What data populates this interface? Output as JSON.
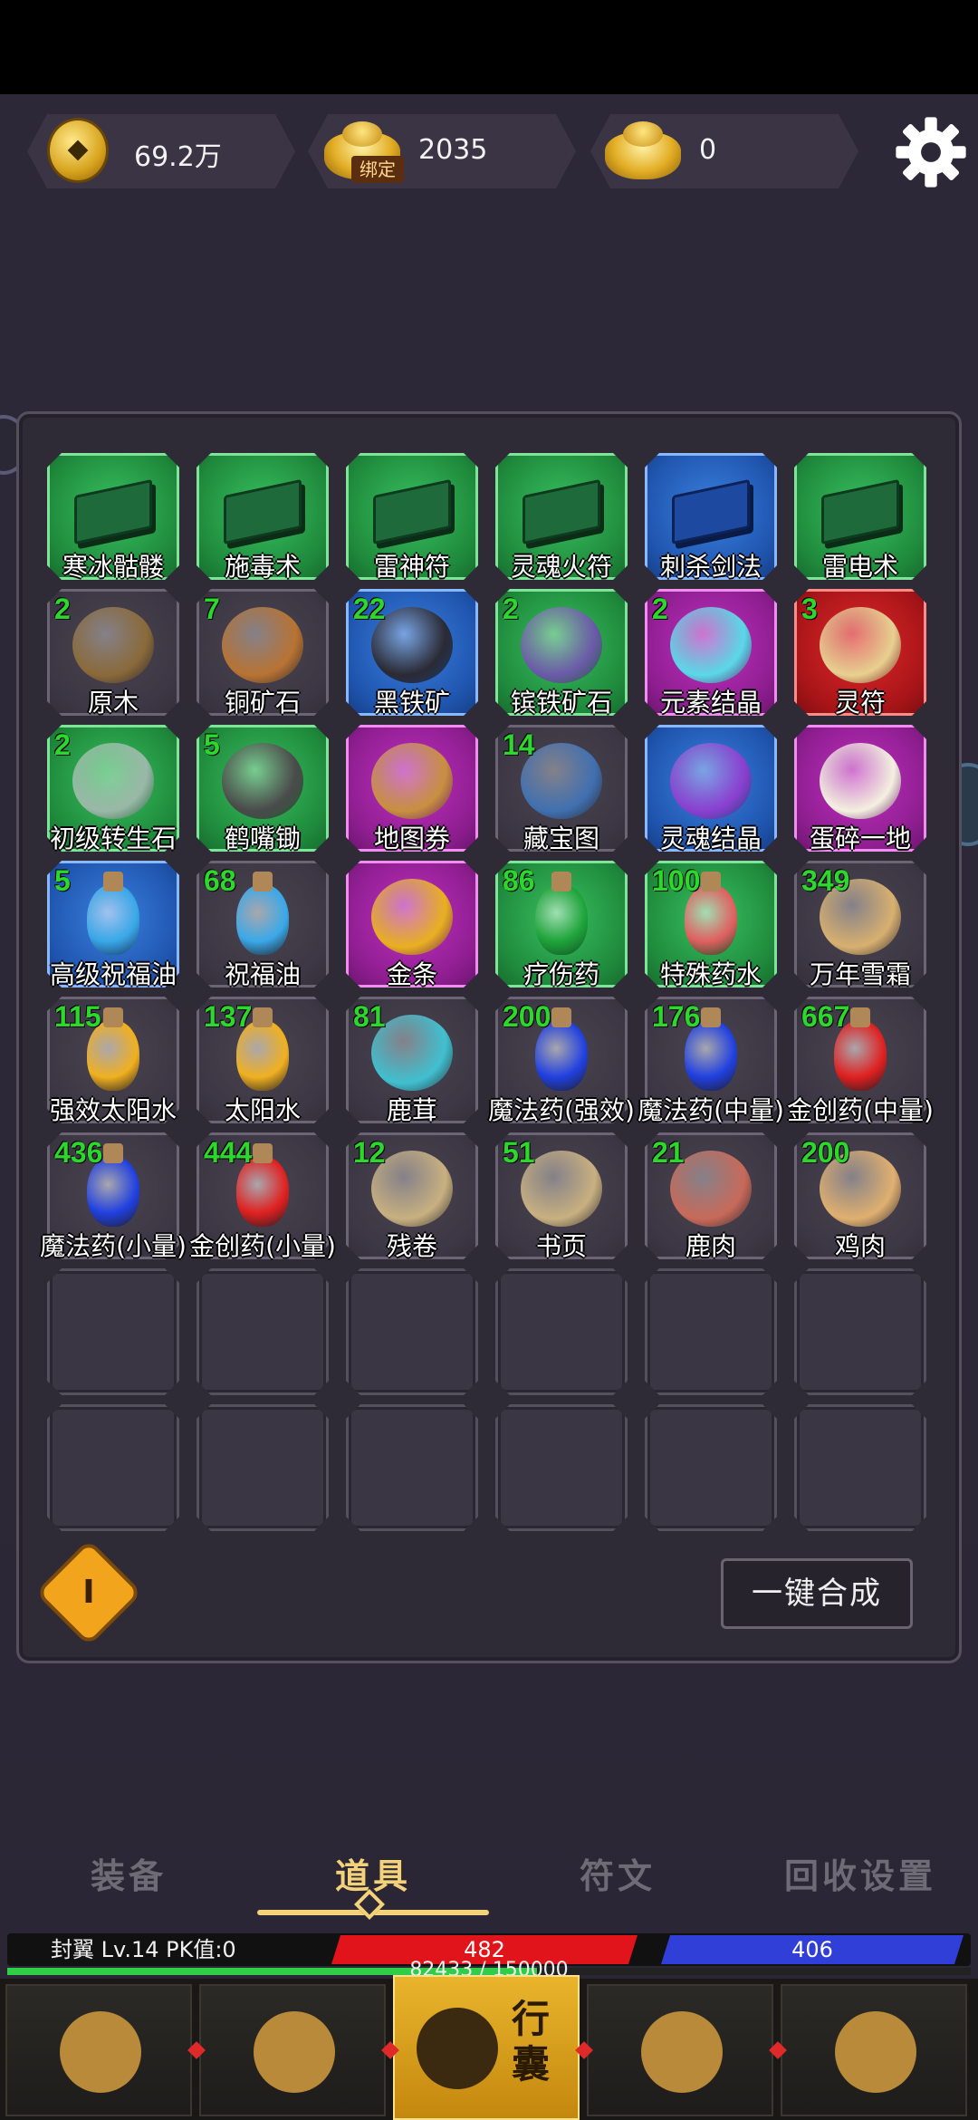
{
  "currencies": [
    {
      "name": "coin",
      "amount": "69.2万"
    },
    {
      "name": "bound-ingot",
      "amount": "2035",
      "tag": "绑定"
    },
    {
      "name": "ingot",
      "amount": "0"
    }
  ],
  "inventory": [
    {
      "label": "寒冰骷髅",
      "count": "",
      "rarity": "green",
      "icon": "skill-book-icon"
    },
    {
      "label": "施毒术",
      "count": "",
      "rarity": "green",
      "icon": "skill-book-icon"
    },
    {
      "label": "雷神符",
      "count": "",
      "rarity": "green",
      "icon": "skill-book-icon"
    },
    {
      "label": "灵魂火符",
      "count": "",
      "rarity": "green",
      "icon": "skill-book-icon"
    },
    {
      "label": "刺杀剑法",
      "count": "",
      "rarity": "blue",
      "icon": "skill-book-icon"
    },
    {
      "label": "雷电术",
      "count": "",
      "rarity": "green",
      "icon": "skill-book-icon"
    },
    {
      "label": "原木",
      "count": "2",
      "rarity": "grey",
      "icon": "log-icon"
    },
    {
      "label": "铜矿石",
      "count": "7",
      "rarity": "grey",
      "icon": "copper-ore-icon"
    },
    {
      "label": "黑铁矿",
      "count": "22",
      "rarity": "blue",
      "icon": "black-iron-ore-icon"
    },
    {
      "label": "镔铁矿石",
      "count": "2",
      "rarity": "green",
      "icon": "crystal-ore-icon"
    },
    {
      "label": "元素结晶",
      "count": "2",
      "rarity": "purple",
      "icon": "element-crystal-icon"
    },
    {
      "label": "灵符",
      "count": "3",
      "rarity": "red",
      "icon": "talisman-icon"
    },
    {
      "label": "初级转生石",
      "count": "2",
      "rarity": "green",
      "icon": "rebirth-stone-icon"
    },
    {
      "label": "鹤嘴锄",
      "count": "5",
      "rarity": "green",
      "icon": "pickaxe-icon"
    },
    {
      "label": "地图券",
      "count": "",
      "rarity": "purple",
      "icon": "map-scroll-icon"
    },
    {
      "label": "藏宝图",
      "count": "14",
      "rarity": "grey",
      "icon": "treasure-map-icon"
    },
    {
      "label": "灵魂结晶",
      "count": "",
      "rarity": "blue",
      "icon": "soul-crystal-icon"
    },
    {
      "label": "蛋碎一地",
      "count": "",
      "rarity": "purple",
      "icon": "broken-egg-icon"
    },
    {
      "label": "高级祝福油",
      "count": "5",
      "rarity": "blue",
      "icon": "blessing-oil-icon"
    },
    {
      "label": "祝福油",
      "count": "68",
      "rarity": "grey",
      "icon": "blessing-oil-icon"
    },
    {
      "label": "金条",
      "count": "",
      "rarity": "purple",
      "icon": "gold-bar-icon"
    },
    {
      "label": "疗伤药",
      "count": "86",
      "rarity": "green",
      "icon": "healing-potion-icon"
    },
    {
      "label": "特殊药水",
      "count": "100",
      "rarity": "green",
      "icon": "special-potion-icon"
    },
    {
      "label": "万年雪霜",
      "count": "349",
      "rarity": "grey",
      "icon": "ginseng-icon"
    },
    {
      "label": "强效太阳水",
      "count": "115",
      "rarity": "grey",
      "icon": "sun-water-icon"
    },
    {
      "label": "太阳水",
      "count": "137",
      "rarity": "grey",
      "icon": "sun-water-icon"
    },
    {
      "label": "鹿茸",
      "count": "81",
      "rarity": "grey",
      "icon": "antler-icon"
    },
    {
      "label": "魔法药(强效)",
      "count": "200",
      "rarity": "grey",
      "icon": "mana-potion-icon"
    },
    {
      "label": "魔法药(中量)",
      "count": "176",
      "rarity": "grey",
      "icon": "mana-potion-icon"
    },
    {
      "label": "金创药(中量)",
      "count": "667",
      "rarity": "grey",
      "icon": "hp-potion-icon"
    },
    {
      "label": "魔法药(小量)",
      "count": "436",
      "rarity": "grey",
      "icon": "mana-potion-icon"
    },
    {
      "label": "金创药(小量)",
      "count": "444",
      "rarity": "grey",
      "icon": "hp-potion-icon"
    },
    {
      "label": "残卷",
      "count": "12",
      "rarity": "grey",
      "icon": "scroll-fragment-icon"
    },
    {
      "label": "书页",
      "count": "51",
      "rarity": "grey",
      "icon": "book-page-icon"
    },
    {
      "label": "鹿肉",
      "count": "21",
      "rarity": "grey",
      "icon": "venison-icon"
    },
    {
      "label": "鸡肉",
      "count": "200",
      "rarity": "grey",
      "icon": "chicken-icon"
    }
  ],
  "empty_slots": 12,
  "page_badge": "Ⅰ",
  "merge_button": "一键合成",
  "tabs": [
    {
      "label": "装备",
      "active": false
    },
    {
      "label": "道具",
      "active": true
    },
    {
      "label": "符文",
      "active": false
    },
    {
      "label": "回收设置",
      "active": false
    }
  ],
  "player": {
    "name_line": "封翼  Lv.14 PK值:0",
    "hp": "482",
    "mp": "406",
    "xp_text": "82433 / 150000",
    "xp_fraction": 0.5496
  },
  "nav": [
    {
      "icon": "town-gate-icon",
      "label": ""
    },
    {
      "icon": "helmet-icon",
      "label": ""
    },
    {
      "icon": "bag-icon",
      "label": "行囊",
      "active": true
    },
    {
      "icon": "meditation-icon",
      "label": ""
    },
    {
      "icon": "yin-yang-icon",
      "label": ""
    }
  ],
  "colors": {
    "green": "#1f8a3c",
    "blue": "#1f55ae",
    "purple": "#8e1e90",
    "red": "#a81518",
    "count_text": "#2bd82b",
    "active_tab": "#f4d27a"
  }
}
